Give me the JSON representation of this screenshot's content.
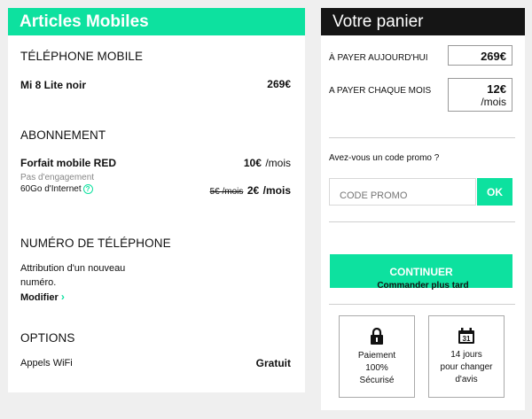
{
  "left": {
    "title": "Articles Mobiles",
    "phone_section": {
      "title": "TÉLÉPHONE MOBILE",
      "product": "Mi 8 Lite noir",
      "price": "269€"
    },
    "subscription": {
      "title": "ABONNEMENT",
      "plan": "Forfait mobile RED",
      "price": "10€",
      "per": "/mois",
      "commitment": "Pas d'engagement",
      "data": "60Go d'Internet",
      "help_icon": "?",
      "old_price": "5€ /mois",
      "option_price": "2€",
      "option_per": "/mois"
    },
    "number": {
      "title": "NUMÉRO DE TÉLÉPHONE",
      "line1": "Attribution d'un nouveau",
      "line2": "numéro.",
      "modify": "Modifier",
      "chevron": "›"
    },
    "options": {
      "title": "OPTIONS",
      "item": "Appels WiFi",
      "value": "Gratuit"
    }
  },
  "right": {
    "title": "Votre panier",
    "today_label": "À PAYER AUJOURD'HUI",
    "today_value": "269€",
    "monthly_label": "A PAYER CHAQUE MOIS",
    "monthly_value": "12€",
    "monthly_unit": "/mois",
    "promo_question": "Avez-vous un code promo ?",
    "promo_placeholder": "CODE PROMO",
    "ok": "OK",
    "continue": "CONTINUER",
    "later": "Commander plus tard",
    "card_secure": {
      "icon": "padlock-icon",
      "line1": "Paiement",
      "line2": "100%",
      "line3": "Sécurisé"
    },
    "card_days": {
      "icon": "calendar-icon",
      "calendar_day": "31",
      "line1": "14 jours",
      "line2": "pour changer",
      "line3": "d'avis"
    }
  },
  "colors": {
    "accent": "#0de19f",
    "dark": "#151515",
    "background": "#efefef"
  }
}
